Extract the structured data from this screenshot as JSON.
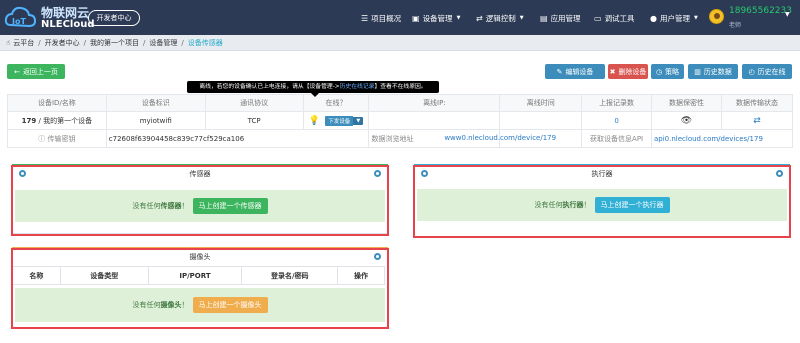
{
  "nav": {
    "brand_cn": "物联网云",
    "brand_en": "NLECloud",
    "dev_center": "开发者中心",
    "items": [
      {
        "label": "项目概况",
        "icon": "menu-icon"
      },
      {
        "label": "设备管理",
        "icon": "device-icon"
      },
      {
        "label": "逻辑控制",
        "icon": "shuffle-icon"
      },
      {
        "label": "应用管理",
        "icon": "app-icon"
      },
      {
        "label": "调试工具",
        "icon": "debug-icon"
      },
      {
        "label": "用户管理",
        "icon": "user-icon"
      }
    ],
    "user_phone": "18965562233",
    "user_role": "老师"
  },
  "breadcrumb": {
    "items": [
      "云平台",
      "开发者中心",
      "我的第一个项目",
      "设备管理",
      "设备传感器"
    ]
  },
  "toolbar": {
    "back": "返回上一页",
    "edit": "编辑设备",
    "delete": "删除设备",
    "policy": "策略",
    "history": "历史数据",
    "history_online": "历史在线"
  },
  "tooltip": {
    "prefix": "离线，若您的设备确认已上电连接，请从【设备管理->",
    "link": "历史在线记录",
    "suffix": "】查看不在线原因。"
  },
  "device_table": {
    "headers": [
      "设备ID/名称",
      "设备标识",
      "通讯协议",
      "在线？",
      "离线IP:",
      "离线时间",
      "上报记录数",
      "数据保密性",
      "数据传输状态"
    ],
    "row1": {
      "id": "179",
      "name": " / 我的第一个设备",
      "identifier": "myiotwifi",
      "protocol": "TCP",
      "online_btn": "下发设备",
      "records": "0"
    },
    "row2": {
      "key_label": "传输密钥",
      "key_value": "c72608f63904458c839c77cf529ca106",
      "browse_label": "数据浏览地址",
      "browse_url": "www0.nlecloud.com/device/179",
      "api_label": "获取设备信息API",
      "api_url": "api0.nlecloud.com/devices/179"
    }
  },
  "sensor_panel": {
    "title": "传感器",
    "empty_prefix": "没有任何",
    "empty_bold": "传感器",
    "empty_suffix": "！",
    "button": "马上创建一个传感器"
  },
  "actuator_panel": {
    "title": "执行器",
    "empty_prefix": "没有任何",
    "empty_bold": "执行器",
    "empty_suffix": "！",
    "button": "马上创建一个执行器"
  },
  "camera_panel": {
    "title": "摄像头",
    "headers": [
      "名称",
      "设备类型",
      "IP/PORT",
      "登录名/密码",
      "操作"
    ],
    "empty_prefix": "没有任何",
    "empty_bold": "摄像头",
    "empty_suffix": "！",
    "button": "马上创建一个摄像头"
  },
  "colors": {
    "nav_bg": "#2c3a55",
    "green": "#3cb55e",
    "blue": "#3c8dbc",
    "red": "#d9534f",
    "orange": "#f0ad4e",
    "teal": "#31b0d5",
    "highlight_frame": "#e8434a"
  }
}
